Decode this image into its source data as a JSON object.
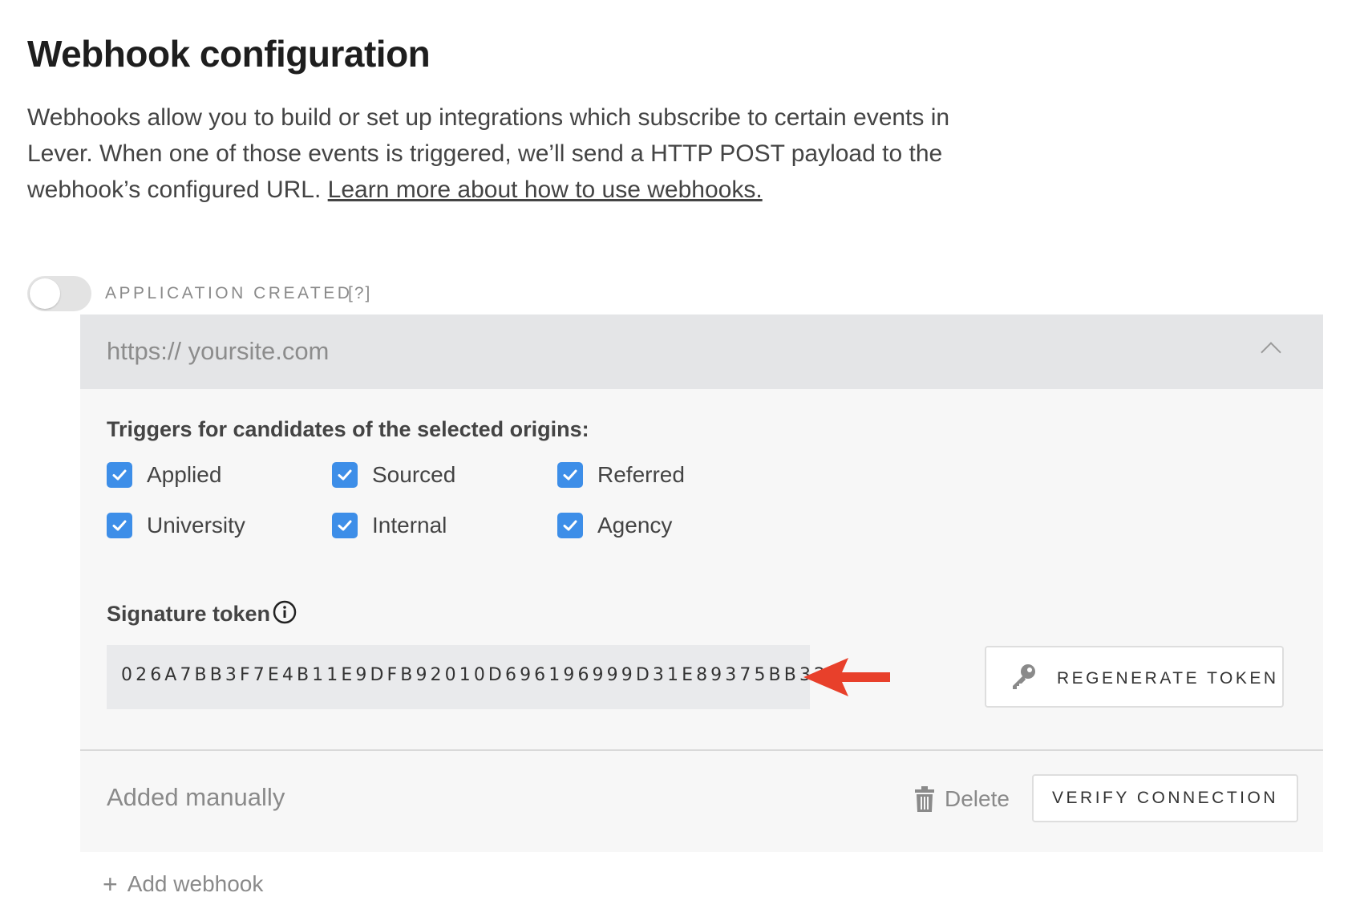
{
  "page": {
    "title": "Webhook configuration",
    "description": "Webhooks allow you to build or set up integrations which subscribe to certain events in Lever. When one of those events is triggered, we’ll send a HTTP POST payload to the webhook’s configured URL. ",
    "learn_more_link": "Learn more about how to use webhooks."
  },
  "event": {
    "label": "APPLICATION CREATED",
    "help": "[?]",
    "enabled": false
  },
  "webhook": {
    "url_placeholder": "https:// yoursite.com",
    "triggers_heading": "Triggers for candidates of the selected origins:",
    "origins": [
      {
        "label": "Applied",
        "checked": true
      },
      {
        "label": "Sourced",
        "checked": true
      },
      {
        "label": "Referred",
        "checked": true
      },
      {
        "label": "University",
        "checked": true
      },
      {
        "label": "Internal",
        "checked": true
      },
      {
        "label": "Agency",
        "checked": true
      }
    ],
    "signature_heading": "Signature token",
    "signature_token": "026A7BB3F7E4B11E9DFB92010D696196999D31E89375BB32",
    "regenerate_label": "REGENERATE TOKEN",
    "added_manually": "Added manually",
    "delete_label": "Delete",
    "verify_label": "VERIFY CONNECTION"
  },
  "add_webhook_label": "Add webhook",
  "colors": {
    "checkbox": "#3d8ee8",
    "arrow": "#e8402b",
    "url_bar": "#e4e5e7",
    "card": "#f7f7f7"
  },
  "icons": [
    "info-icon",
    "key-icon",
    "trash-icon",
    "chevron-up-icon",
    "plus-icon",
    "arrow-left-icon",
    "checkmark-icon"
  ]
}
